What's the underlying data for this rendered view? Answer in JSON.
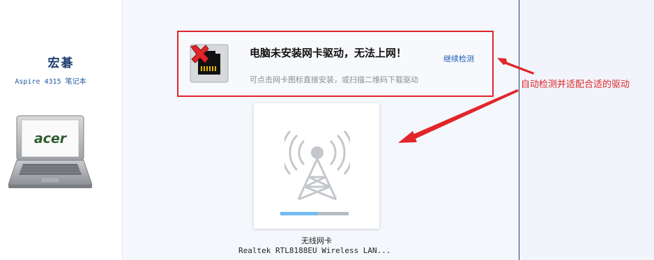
{
  "sidebar": {
    "brand": "宏碁",
    "model": "Aspire 4315 笔记本",
    "laptop_logo": "acer"
  },
  "alert": {
    "title": "电脑未安装网卡驱动，无法上网！",
    "redetect_link": "继续检测",
    "hint": "可点击网卡图标直接安装，或扫描二维码下载驱动",
    "icon": "network-card-error-icon"
  },
  "device": {
    "icon": "wireless-tower-icon",
    "progress_fraction": 0.55,
    "name": "无线网卡",
    "model": "Realtek RTL8188EU Wireless LAN..."
  },
  "annotation": {
    "text": "自动检测并适配合适的驱动"
  },
  "colors": {
    "highlight_red": "#e0262b",
    "link_blue": "#1a5fb4",
    "brand_navy": "#1d3f6e",
    "progress_fill": "#76bbef"
  }
}
